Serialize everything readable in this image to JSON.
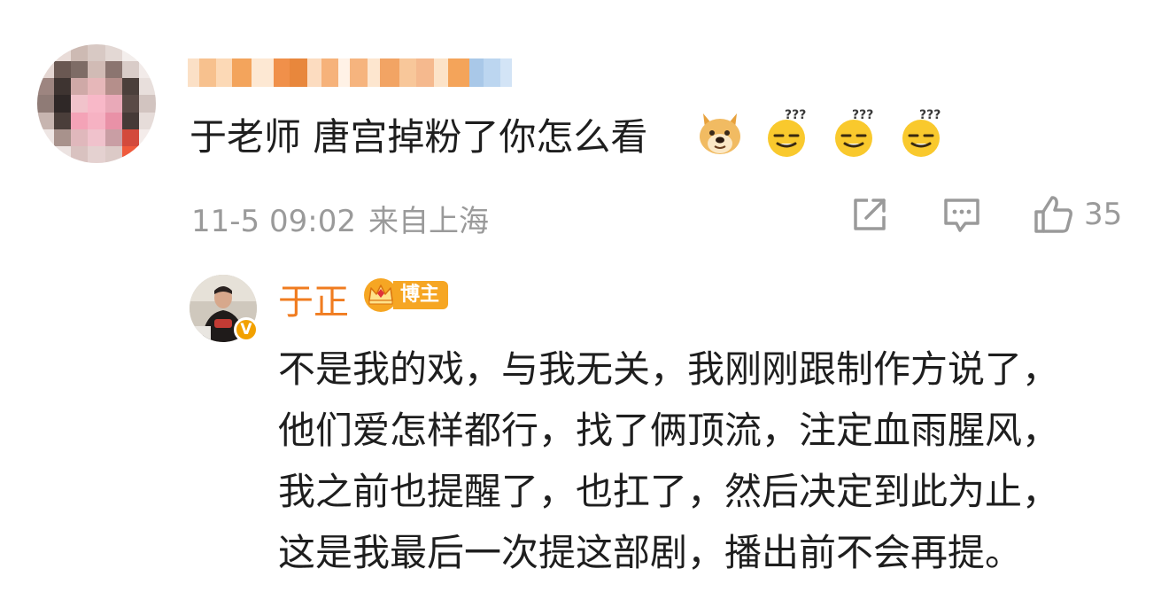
{
  "comment": {
    "text": "于老师 唐宫掉粉了你怎么看",
    "emojis": [
      "doge-emoji",
      "confused-emoji",
      "confused-emoji",
      "confused-emoji"
    ],
    "time": "11-5 09:02",
    "location": "来自上海",
    "like_count": "35"
  },
  "reply": {
    "author": "于正",
    "badge": "博主",
    "verified_mark": "V",
    "lines": [
      "不是我的戏，与我无关，我刚刚跟制作方说了，",
      "他们爱怎样都行，找了俩顶流，注定血雨腥风，",
      "我之前也提醒了，也扛了，然后决定到此为止，",
      "这是我最后一次提这部剧，播出前不会再提。"
    ]
  },
  "colors": {
    "name_orange": "#f07c20",
    "meta_gray": "#9a9a9a",
    "badge_orange": "#f6a623",
    "verified_gold": "#f2a100"
  }
}
